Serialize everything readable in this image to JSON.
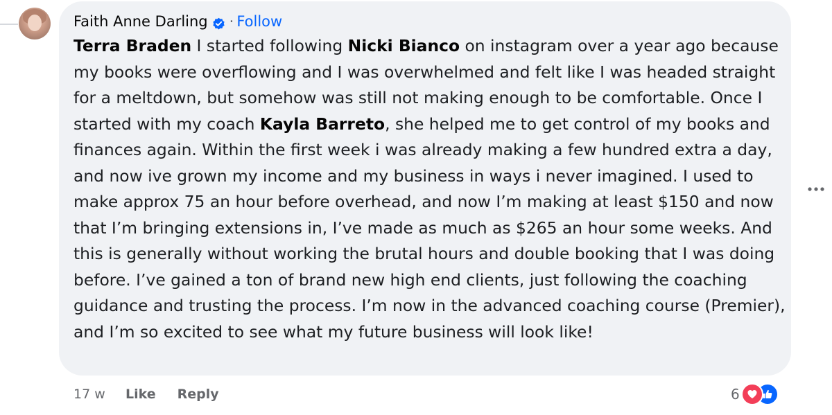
{
  "comment": {
    "author": "Faith Anne Darling",
    "separator": "·",
    "follow_label": "Follow",
    "segments": [
      {
        "text": "Terra Braden",
        "mention": true
      },
      {
        "text": " I started following ",
        "mention": false
      },
      {
        "text": "Nicki Bianco",
        "mention": true
      },
      {
        "text": " on instagram over a year ago because my books were overflowing and I was overwhelmed and felt like I was headed straight for a meltdown, but somehow was still not making enough to be comfortable. Once I started with my coach ",
        "mention": false
      },
      {
        "text": "Kayla Barreto",
        "mention": true
      },
      {
        "text": ", she helped me to get control of my books and finances again. Within the first week i was already making a few hundred extra a day, and now ive grown my income and my business in ways i never imagined. I used to make approx 75 an hour before overhead, and now I’m making at least $150 and now that I’m bringing extensions in, I’ve made as much as $265 an hour some weeks. And this is generally without working the brutal hours and double booking that I was doing before. I’ve gained a ton of brand new high end clients, just following the coaching guidance and trusting the process. I’m now in the advanced coaching course (Premier), and I’m so excited to see what my future business will look like!",
        "mention": false
      }
    ],
    "timestamp": "17 w",
    "like_label": "Like",
    "reply_label": "Reply",
    "reaction_count": "6",
    "reaction_icons": [
      "heart-icon",
      "thumbs-up-icon"
    ]
  },
  "colors": {
    "bubble": "#f0f2f5",
    "follow": "#0866ff",
    "heart": "#f33e58",
    "like": "#0866ff",
    "muted": "#65676b"
  }
}
